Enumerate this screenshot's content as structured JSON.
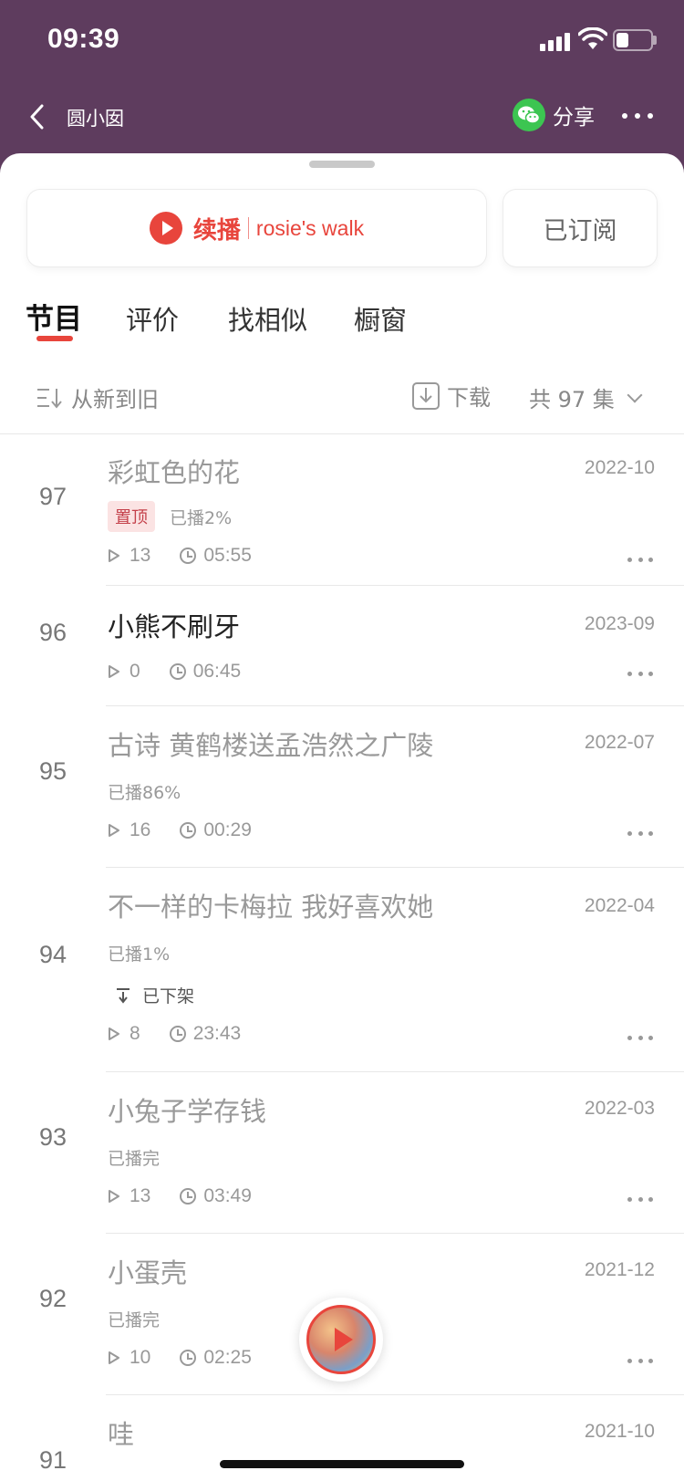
{
  "status_bar": {
    "time": "09:39",
    "battery_level": 0.35
  },
  "nav": {
    "back_icon": "chevron-left-icon",
    "title": "圆小囡",
    "share_label": "分享",
    "share_icon": "wechat-icon",
    "more_icon": "more-horizontal-icon"
  },
  "resume": {
    "label": "续播",
    "episode_title": "rosie's walk"
  },
  "subscribe": {
    "label": "已订阅"
  },
  "tabs": [
    {
      "label": "节目",
      "active": true
    },
    {
      "label": "评价",
      "active": false
    },
    {
      "label": "找相似",
      "active": false
    },
    {
      "label": "橱窗",
      "active": false
    }
  ],
  "toolbar": {
    "sort_label": "从新到旧",
    "download_label": "下载",
    "count_label": "共 97 集"
  },
  "episodes": [
    {
      "num": "97",
      "title": "彩虹色的花",
      "date": "2022-10",
      "pinned": "置顶",
      "progress": "已播2%",
      "plays": "13",
      "duration": "05:55",
      "played": true
    },
    {
      "num": "96",
      "title": "小熊不刷牙",
      "date": "2023-09",
      "pinned": "",
      "progress": "",
      "plays": "0",
      "duration": "06:45",
      "played": false
    },
    {
      "num": "95",
      "title": "古诗 黄鹤楼送孟浩然之广陵",
      "date": "2022-07",
      "pinned": "",
      "progress": "已播86%",
      "plays": "16",
      "duration": "00:29",
      "played": true
    },
    {
      "num": "94",
      "title": "不一样的卡梅拉 我好喜欢她",
      "date": "2022-04",
      "pinned": "",
      "progress": "已播1%",
      "removed": "已下架",
      "plays": "8",
      "duration": "23:43",
      "played": true
    },
    {
      "num": "93",
      "title": "小兔子学存钱",
      "date": "2022-03",
      "pinned": "",
      "progress": "已播完",
      "plays": "13",
      "duration": "03:49",
      "played": true
    },
    {
      "num": "92",
      "title": "小蛋壳",
      "date": "2021-12",
      "pinned": "",
      "progress": "已播完",
      "plays": "10",
      "duration": "02:25",
      "played": true
    },
    {
      "num": "91",
      "title": "哇",
      "date": "2021-10",
      "pinned": "",
      "progress": "",
      "plays": "",
      "duration": "",
      "played": true
    }
  ]
}
